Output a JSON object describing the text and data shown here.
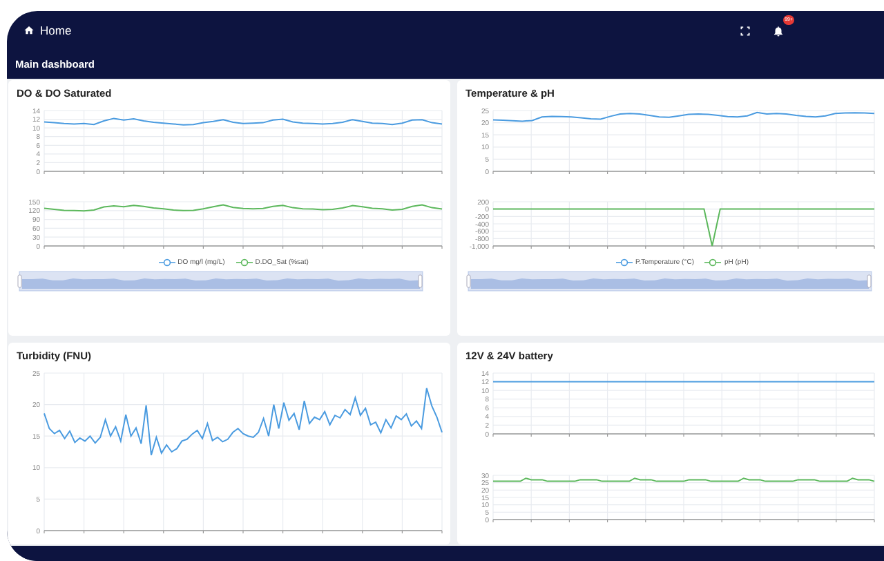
{
  "header": {
    "home_label": "Home",
    "notification_badge": "99+"
  },
  "dashboard": {
    "title": "Main dashboard"
  },
  "panels": [
    {
      "title": "DO & DO Saturated",
      "legend": true,
      "zoom": {
        "level": 1
      },
      "charts": [
        {
          "chart_data": {
            "type": "line",
            "grid": true,
            "ylim": [
              0,
              14
            ],
            "yticks": [
              0,
              2,
              4,
              6,
              8,
              10,
              12,
              14
            ],
            "series": [
              {
                "name": "DO mg/l (mg/L)",
                "color": "#4a9be0",
                "values": [
                  11.4,
                  11.2,
                  11.0,
                  10.9,
                  11.0,
                  10.8,
                  11.6,
                  12.2,
                  11.8,
                  12.1,
                  11.6,
                  11.3,
                  11.1,
                  10.9,
                  10.7,
                  10.8,
                  11.2,
                  11.5,
                  11.9,
                  11.3,
                  11.0,
                  11.1,
                  11.2,
                  11.8,
                  12.0,
                  11.4,
                  11.1,
                  11.0,
                  10.9,
                  11.0,
                  11.3,
                  11.9,
                  11.5,
                  11.1,
                  11.0,
                  10.8,
                  11.1,
                  11.8,
                  11.9,
                  11.2,
                  10.9
                ]
              }
            ]
          }
        },
        {
          "chart_data": {
            "type": "line",
            "grid": true,
            "ylim": [
              0,
              150
            ],
            "yticks": [
              0,
              30,
              60,
              90,
              120,
              150
            ],
            "series": [
              {
                "name": "D.DO_Sat (%sat)",
                "color": "#5cb85c",
                "values": [
                  128,
                  124,
                  121,
                  120,
                  119,
                  122,
                  132,
                  136,
                  133,
                  138,
                  134,
                  129,
                  126,
                  122,
                  120,
                  121,
                  126,
                  133,
                  139,
                  131,
                  127,
                  126,
                  127,
                  134,
                  138,
                  130,
                  126,
                  125,
                  123,
                  124,
                  129,
                  137,
                  133,
                  128,
                  126,
                  122,
                  124,
                  134,
                  139,
                  130,
                  125
                ]
              }
            ]
          }
        }
      ]
    },
    {
      "title": "Temperature & pH",
      "legend": true,
      "zoom": {
        "level": 1
      },
      "charts": [
        {
          "chart_data": {
            "type": "line",
            "grid": true,
            "ylim": [
              0,
              25
            ],
            "yticks": [
              0,
              5,
              10,
              15,
              20,
              25
            ],
            "series": [
              {
                "name": "P.Temperature (°C)",
                "color": "#4a9be0",
                "values": [
                  21.2,
                  21.0,
                  20.8,
                  20.6,
                  20.9,
                  22.4,
                  22.6,
                  22.5,
                  22.4,
                  22.0,
                  21.6,
                  21.5,
                  22.6,
                  23.6,
                  23.8,
                  23.6,
                  23.0,
                  22.4,
                  22.2,
                  22.8,
                  23.4,
                  23.6,
                  23.4,
                  23.0,
                  22.5,
                  22.4,
                  22.8,
                  24.2,
                  23.6,
                  23.8,
                  23.6,
                  23.0,
                  22.6,
                  22.4,
                  22.8,
                  23.8,
                  24.0,
                  24.1,
                  24.0,
                  23.8
                ]
              }
            ]
          }
        },
        {
          "chart_data": {
            "type": "line",
            "grid": true,
            "ylim": [
              -1000,
              200
            ],
            "yticks": [
              {
                "value": -1000,
                "label": "-1,000"
              },
              -800,
              -600,
              -400,
              -200,
              0,
              200
            ],
            "series": [
              {
                "name": "pH (pH)",
                "color": "#5cb85c",
                "values": [
                  0,
                  0,
                  0,
                  0,
                  0,
                  0,
                  0,
                  0,
                  0,
                  0,
                  0,
                  0,
                  0,
                  0,
                  0,
                  0,
                  0,
                  0,
                  0,
                  0,
                  0,
                  0,
                  0,
                  0,
                  0,
                  0,
                  0,
                  -1000,
                  0,
                  0,
                  0,
                  0,
                  0,
                  0,
                  0,
                  0,
                  0,
                  0,
                  0,
                  0,
                  0,
                  0,
                  0,
                  0,
                  0,
                  0,
                  0,
                  0
                ]
              }
            ]
          }
        }
      ]
    },
    {
      "title": "Turbidity (FNU)",
      "legend": false,
      "charts": [
        {
          "chart_data": {
            "type": "line",
            "grid": true,
            "ylim": [
              0,
              25
            ],
            "yticks": [
              0,
              5,
              10,
              15,
              20,
              25
            ],
            "series": [
              {
                "color": "#4a9be0",
                "values": [
                  18.6,
                  16.2,
                  15.4,
                  15.9,
                  14.6,
                  15.8,
                  14.0,
                  14.7,
                  14.2,
                  15.0,
                  13.9,
                  14.8,
                  17.6,
                  15.0,
                  16.5,
                  14.2,
                  18.4,
                  15.0,
                  16.3,
                  13.8,
                  19.9,
                  12.0,
                  14.8,
                  12.3,
                  13.6,
                  12.5,
                  13.0,
                  14.2,
                  14.5,
                  15.3,
                  15.9,
                  14.6,
                  17.0,
                  14.3,
                  14.8,
                  14.1,
                  14.5,
                  15.6,
                  16.2,
                  15.4,
                  15.0,
                  14.8,
                  15.6,
                  17.8,
                  15.0,
                  20.0,
                  16.2,
                  20.3,
                  17.5,
                  18.6,
                  16.0,
                  20.6,
                  17.0,
                  18.0,
                  17.6,
                  18.9,
                  16.8,
                  18.3,
                  17.9,
                  19.2,
                  18.4,
                  21.1,
                  18.3,
                  19.4,
                  16.8,
                  17.2,
                  15.5,
                  17.6,
                  16.3,
                  18.2,
                  17.6,
                  18.5,
                  16.6,
                  17.4,
                  16.2,
                  22.6,
                  19.8,
                  18.0,
                  15.6
                ]
              }
            ]
          }
        }
      ]
    },
    {
      "title": "12V & 24V battery",
      "legend": false,
      "charts": [
        {
          "chart_data": {
            "type": "line",
            "grid": true,
            "ylim": [
              0,
              14
            ],
            "yticks": [
              0,
              2,
              4,
              6,
              8,
              10,
              12,
              14
            ],
            "series": [
              {
                "color": "#4a9be0",
                "values": [
                  12,
                  12,
                  12,
                  12,
                  12,
                  12,
                  12,
                  12,
                  12,
                  12,
                  12,
                  12,
                  12,
                  12,
                  12,
                  12,
                  12,
                  12,
                  12,
                  12
                ]
              }
            ]
          }
        },
        {
          "chart_data": {
            "type": "line",
            "grid": true,
            "ylim": [
              0,
              30
            ],
            "yticks": [
              0,
              5,
              10,
              15,
              20,
              25,
              30
            ],
            "series": [
              {
                "color": "#5cb85c",
                "values": [
                  26,
                  26,
                  26,
                  26,
                  26,
                  26,
                  28,
                  27,
                  27,
                  27,
                  26,
                  26,
                  26,
                  26,
                  26,
                  26,
                  27,
                  27,
                  27,
                  27,
                  26,
                  26,
                  26,
                  26,
                  26,
                  26,
                  28,
                  27,
                  27,
                  27,
                  26,
                  26,
                  26,
                  26,
                  26,
                  26,
                  27,
                  27,
                  27,
                  27,
                  26,
                  26,
                  26,
                  26,
                  26,
                  26,
                  28,
                  27,
                  27,
                  27,
                  26,
                  26,
                  26,
                  26,
                  26,
                  26,
                  27,
                  27,
                  27,
                  27,
                  26,
                  26,
                  26,
                  26,
                  26,
                  26,
                  28,
                  27,
                  27,
                  27,
                  26
                ]
              }
            ]
          }
        }
      ]
    }
  ]
}
